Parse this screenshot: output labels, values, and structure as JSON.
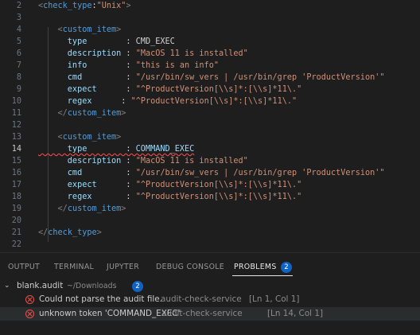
{
  "editor": {
    "lines": [
      {
        "num": "2",
        "tokens": [
          {
            "t": "<",
            "c": "br"
          },
          {
            "t": "check_type",
            "c": "tag"
          },
          {
            "t": ":",
            "c": "plain"
          },
          {
            "t": "\"Unix\"",
            "c": "val"
          },
          {
            "t": ">",
            "c": "br"
          }
        ]
      },
      {
        "num": "3",
        "tokens": []
      },
      {
        "num": "4",
        "tokens": [
          {
            "t": "    ",
            "c": "plain"
          },
          {
            "t": "<",
            "c": "br"
          },
          {
            "t": "custom_item",
            "c": "tag"
          },
          {
            "t": ">",
            "c": "br"
          }
        ]
      },
      {
        "num": "5",
        "tokens": [
          {
            "t": "      type        ",
            "c": "attr"
          },
          {
            "t": ": CMD_EXEC",
            "c": "plain"
          }
        ]
      },
      {
        "num": "6",
        "tokens": [
          {
            "t": "      description ",
            "c": "attr"
          },
          {
            "t": ": ",
            "c": "plain"
          },
          {
            "t": "\"MacOS 11 is installed\"",
            "c": "val"
          }
        ]
      },
      {
        "num": "7",
        "tokens": [
          {
            "t": "      info        ",
            "c": "attr"
          },
          {
            "t": ": ",
            "c": "plain"
          },
          {
            "t": "\"this is an info\"",
            "c": "val"
          }
        ]
      },
      {
        "num": "8",
        "tokens": [
          {
            "t": "      cmd         ",
            "c": "attr"
          },
          {
            "t": ": ",
            "c": "plain"
          },
          {
            "t": "\"/usr/bin/sw_vers | /usr/bin/grep 'ProductVersion'\"",
            "c": "val"
          }
        ]
      },
      {
        "num": "9",
        "tokens": [
          {
            "t": "      expect      ",
            "c": "attr"
          },
          {
            "t": ": ",
            "c": "plain"
          },
          {
            "t": "\"^ProductVersion[\\\\s]*:[\\\\s]*11\\.\"",
            "c": "val"
          }
        ]
      },
      {
        "num": "10",
        "tokens": [
          {
            "t": "      regex      ",
            "c": "attr"
          },
          {
            "t": ": ",
            "c": "plain"
          },
          {
            "t": "\"^ProductVersion[\\\\s]*:[\\\\s]*11\\.\"",
            "c": "val"
          }
        ]
      },
      {
        "num": "11",
        "tokens": [
          {
            "t": "    ",
            "c": "plain"
          },
          {
            "t": "</",
            "c": "br"
          },
          {
            "t": "custom_item",
            "c": "tag"
          },
          {
            "t": ">",
            "c": "br"
          }
        ]
      },
      {
        "num": "12",
        "tokens": []
      },
      {
        "num": "13",
        "tokens": [
          {
            "t": "    ",
            "c": "plain"
          },
          {
            "t": "<",
            "c": "br"
          },
          {
            "t": "custom_item",
            "c": "tag"
          },
          {
            "t": ">",
            "c": "br"
          }
        ]
      },
      {
        "num": "14",
        "active": true,
        "tokens": [
          {
            "t": "      type        : COMMAND_EXEC",
            "c": "attr squig"
          }
        ]
      },
      {
        "num": "15",
        "tokens": [
          {
            "t": "      description ",
            "c": "attr"
          },
          {
            "t": ": ",
            "c": "plain"
          },
          {
            "t": "\"MacOS 11 is installed\"",
            "c": "val"
          }
        ]
      },
      {
        "num": "16",
        "tokens": [
          {
            "t": "      cmd         ",
            "c": "attr"
          },
          {
            "t": ": ",
            "c": "plain"
          },
          {
            "t": "\"/usr/bin/sw_vers | /usr/bin/grep 'ProductVersion'\"",
            "c": "val"
          }
        ]
      },
      {
        "num": "17",
        "tokens": [
          {
            "t": "      expect      ",
            "c": "attr"
          },
          {
            "t": ": ",
            "c": "plain"
          },
          {
            "t": "\"^ProductVersion[\\\\s]*:[\\\\s]*11\\.\"",
            "c": "val"
          }
        ]
      },
      {
        "num": "18",
        "tokens": [
          {
            "t": "      regex       ",
            "c": "attr"
          },
          {
            "t": ": ",
            "c": "plain"
          },
          {
            "t": "\"^ProductVersion[\\\\s]*:[\\\\s]*11\\.\"",
            "c": "val"
          }
        ]
      },
      {
        "num": "19",
        "tokens": [
          {
            "t": "    ",
            "c": "plain"
          },
          {
            "t": "</",
            "c": "br"
          },
          {
            "t": "custom_item",
            "c": "tag"
          },
          {
            "t": ">",
            "c": "br"
          }
        ]
      },
      {
        "num": "20",
        "tokens": []
      },
      {
        "num": "21",
        "tokens": [
          {
            "t": "",
            "c": "plain"
          },
          {
            "t": "</",
            "c": "br"
          },
          {
            "t": "check_type",
            "c": "tag"
          },
          {
            "t": ">",
            "c": "br"
          }
        ]
      },
      {
        "num": "22",
        "tokens": []
      }
    ]
  },
  "panel": {
    "tabs": [
      "OUTPUT",
      "TERMINAL",
      "JUPYTER",
      "DEBUG CONSOLE",
      "PROBLEMS"
    ],
    "active_tab": "PROBLEMS",
    "problem_count": "2",
    "file": {
      "name": "blank.audit",
      "path": "~/Downloads",
      "count": "2"
    },
    "problems": [
      {
        "message": "Could not parse the audit file.",
        "source": "audit-check-service",
        "location": "[Ln 1, Col 1]"
      },
      {
        "message": "unknown token 'COMMAND_EXEC'",
        "source": "audit-check-service",
        "location": "[Ln 14, Col 1]"
      }
    ]
  },
  "colors": {
    "error": "#f14c4c",
    "badge": "#0e63c4",
    "tag": "#569cd6",
    "string": "#ce9178",
    "attribute": "#9cdcfe"
  }
}
